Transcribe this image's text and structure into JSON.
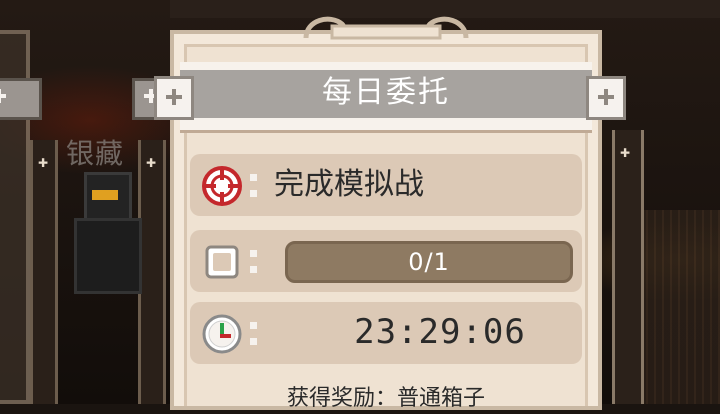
{
  "background": {
    "side_label": "银藏"
  },
  "commission": {
    "title": "每日委托",
    "task": {
      "icon": "target-icon",
      "text": "完成模拟战"
    },
    "progress": {
      "icon": "checkbox-icon",
      "current": 0,
      "total": 1,
      "text": "0/1"
    },
    "timer": {
      "icon": "clock-icon",
      "text": "23:29:06"
    },
    "reward_text": "获得奖励：普通箱子"
  },
  "colors": {
    "card_bg": "#efe2d2",
    "row_bg": "#dcc9b6",
    "title_band": "#a7a39f",
    "progress_track": "#8e7a62",
    "target_red": "#c4282c"
  }
}
